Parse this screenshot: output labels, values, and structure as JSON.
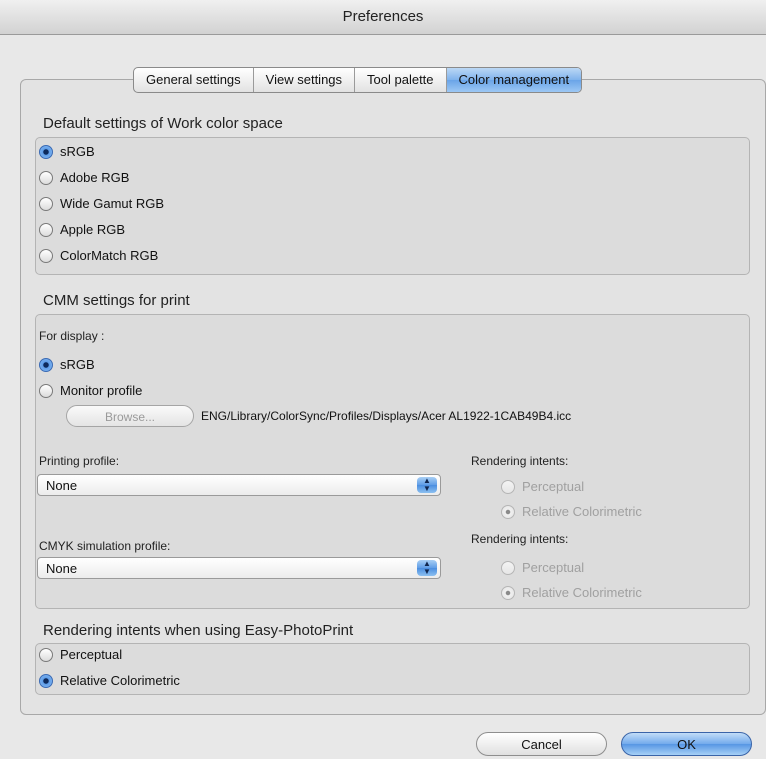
{
  "window": {
    "title": "Preferences"
  },
  "tabs": [
    {
      "label": "General settings"
    },
    {
      "label": "View settings"
    },
    {
      "label": "Tool palette"
    },
    {
      "label": "Color management"
    }
  ],
  "work_color_space": {
    "title": "Default settings of Work color space",
    "options": [
      {
        "label": "sRGB",
        "selected": true
      },
      {
        "label": "Adobe RGB",
        "selected": false
      },
      {
        "label": "Wide Gamut RGB",
        "selected": false
      },
      {
        "label": "Apple RGB",
        "selected": false
      },
      {
        "label": "ColorMatch RGB",
        "selected": false
      }
    ]
  },
  "cmm": {
    "title": "CMM settings for print",
    "for_display_label": "For display :",
    "display_options": [
      {
        "label": "sRGB",
        "selected": true
      },
      {
        "label": "Monitor profile",
        "selected": false
      }
    ],
    "browse_label": "Browse...",
    "profile_path": "ENG/Library/ColorSync/Profiles/Displays/Acer AL1922-1CAB49B4.icc",
    "printing_profile": {
      "label": "Printing profile:",
      "value": "None",
      "intents_label": "Rendering intents:",
      "intents": [
        {
          "label": "Perceptual",
          "selected": false
        },
        {
          "label": "Relative Colorimetric",
          "selected": true
        }
      ]
    },
    "cmyk_profile": {
      "label": "CMYK simulation profile:",
      "value": "None",
      "intents_label": "Rendering intents:",
      "intents": [
        {
          "label": "Perceptual",
          "selected": false
        },
        {
          "label": "Relative Colorimetric",
          "selected": true
        }
      ]
    }
  },
  "easy_photoprint": {
    "title": "Rendering intents when using Easy-PhotoPrint",
    "options": [
      {
        "label": "Perceptual",
        "selected": false
      },
      {
        "label": "Relative Colorimetric",
        "selected": true
      }
    ]
  },
  "buttons": {
    "cancel": "Cancel",
    "ok": "OK"
  },
  "colors": {
    "accent": "#6aa4e8",
    "background": "#e6e6e6"
  }
}
